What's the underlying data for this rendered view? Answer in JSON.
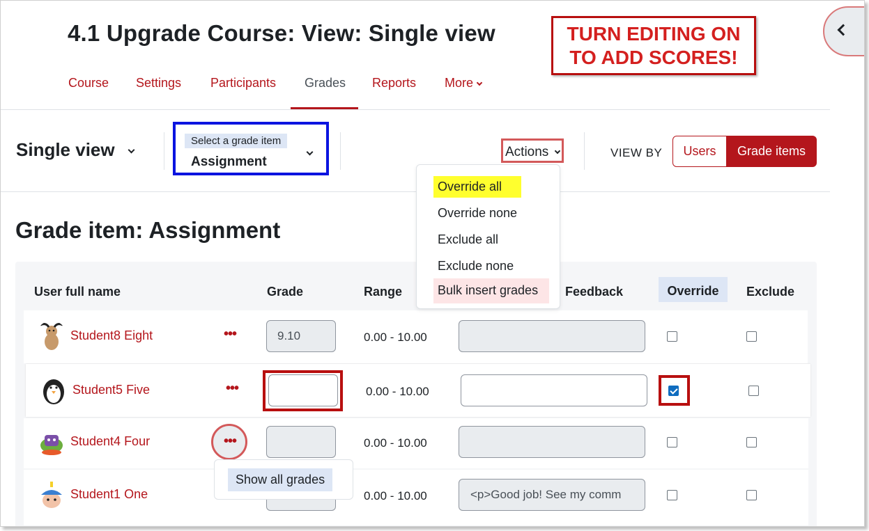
{
  "page": {
    "title": "4.1 Upgrade Course: View: Single view",
    "callout": "TURN EDITING ON\nTO ADD SCORES!"
  },
  "nav": {
    "items": [
      {
        "label": "Course"
      },
      {
        "label": "Settings"
      },
      {
        "label": "Participants"
      },
      {
        "label": "Grades"
      },
      {
        "label": "Reports"
      },
      {
        "label": "More"
      }
    ],
    "active": "Grades"
  },
  "toolbar": {
    "view_title": "Single view",
    "grade_select_label": "Select a grade item",
    "grade_select_value": "Assignment",
    "actions_label": "Actions",
    "view_by_label": "VIEW BY",
    "view_by_users": "Users",
    "view_by_items": "Grade items"
  },
  "actions_menu": {
    "items": [
      "Override all",
      "Override none",
      "Exclude all",
      "Exclude none",
      "Bulk insert grades"
    ]
  },
  "main": {
    "heading": "Grade item: Assignment"
  },
  "table": {
    "headers": {
      "name": "User full name",
      "grade": "Grade",
      "range": "Range",
      "feedback": "Feedback",
      "override": "Override",
      "exclude": "Exclude"
    },
    "rows": [
      {
        "name": "Student8 Eight",
        "grade": "9.10",
        "range": "0.00 - 10.00",
        "feedback": "",
        "override": false,
        "exclude": false
      },
      {
        "name": "Student5 Five",
        "grade": "",
        "range": "0.00 - 10.00",
        "feedback": "",
        "override": true,
        "exclude": false
      },
      {
        "name": "Student4 Four",
        "grade": "",
        "range": "0.00 - 10.00",
        "feedback": "",
        "override": false,
        "exclude": false
      },
      {
        "name": "Student1 One",
        "grade": "",
        "range": "0.00 - 10.00",
        "feedback": "<p>Good job! See my comm",
        "override": false,
        "exclude": false
      }
    ],
    "row_menu_icon": "ellipsis-icon"
  },
  "row_popup": {
    "item": "Show all grades"
  },
  "colors": {
    "brand": "#b4161c",
    "highlight_blue": "#0b14e0",
    "callout_red": "#d4201f",
    "yellow_highlight": "#ffff2e"
  }
}
